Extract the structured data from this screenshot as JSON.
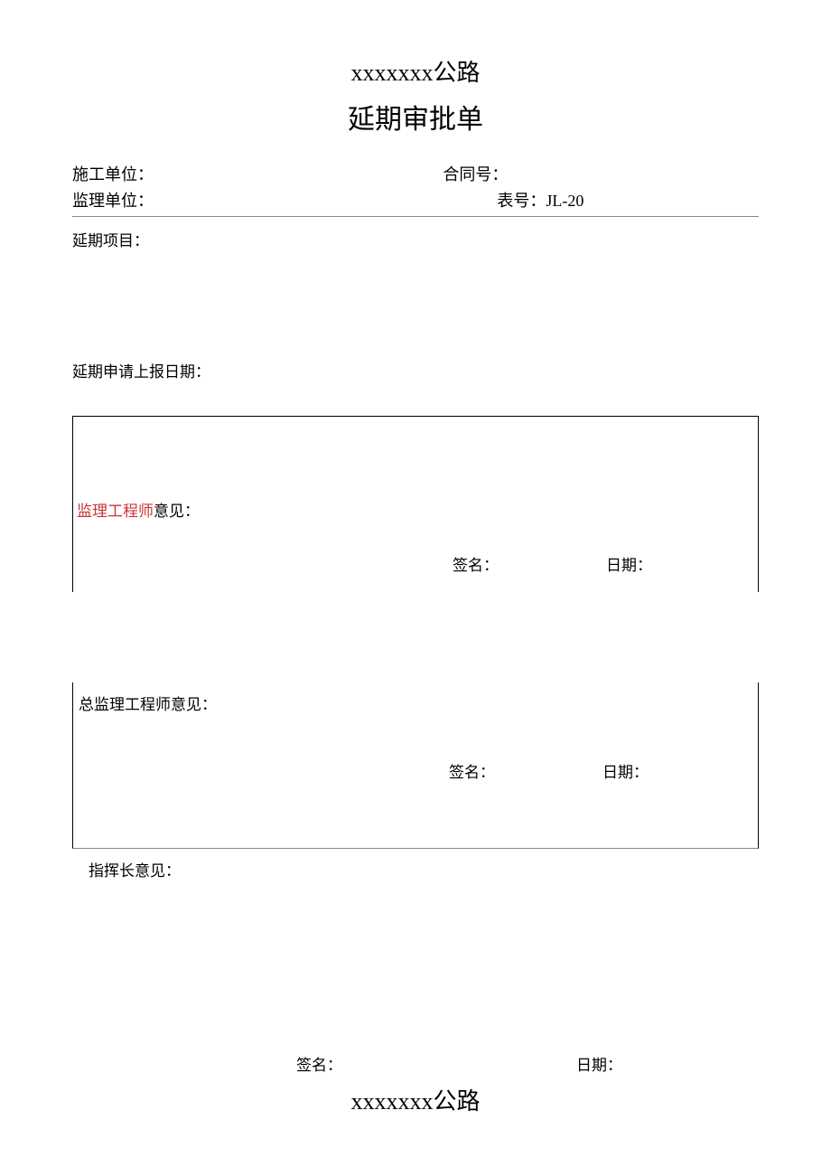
{
  "header": {
    "road_name": "xxxxxxx公路",
    "form_title": "延期审批单"
  },
  "info": {
    "construction_unit_label": "施工单位：",
    "contract_no_label": "合同号：",
    "supervision_unit_label": "监理单位：",
    "form_no_label": "表号：JL-20"
  },
  "sections": {
    "delay_project_label": "延期项目：",
    "delay_report_date_label": "延期申请上报日期：",
    "supervisor_opinion_prefix": "监理工程师",
    "supervisor_opinion_suffix": "意见：",
    "chief_supervisor_opinion_label": "总监理工程师意见：",
    "commander_opinion_label": "指挥长意见："
  },
  "fields": {
    "sign_label": "签名：",
    "date_label": "日期："
  },
  "footer": {
    "road_name": "xxxxxxx公路"
  }
}
